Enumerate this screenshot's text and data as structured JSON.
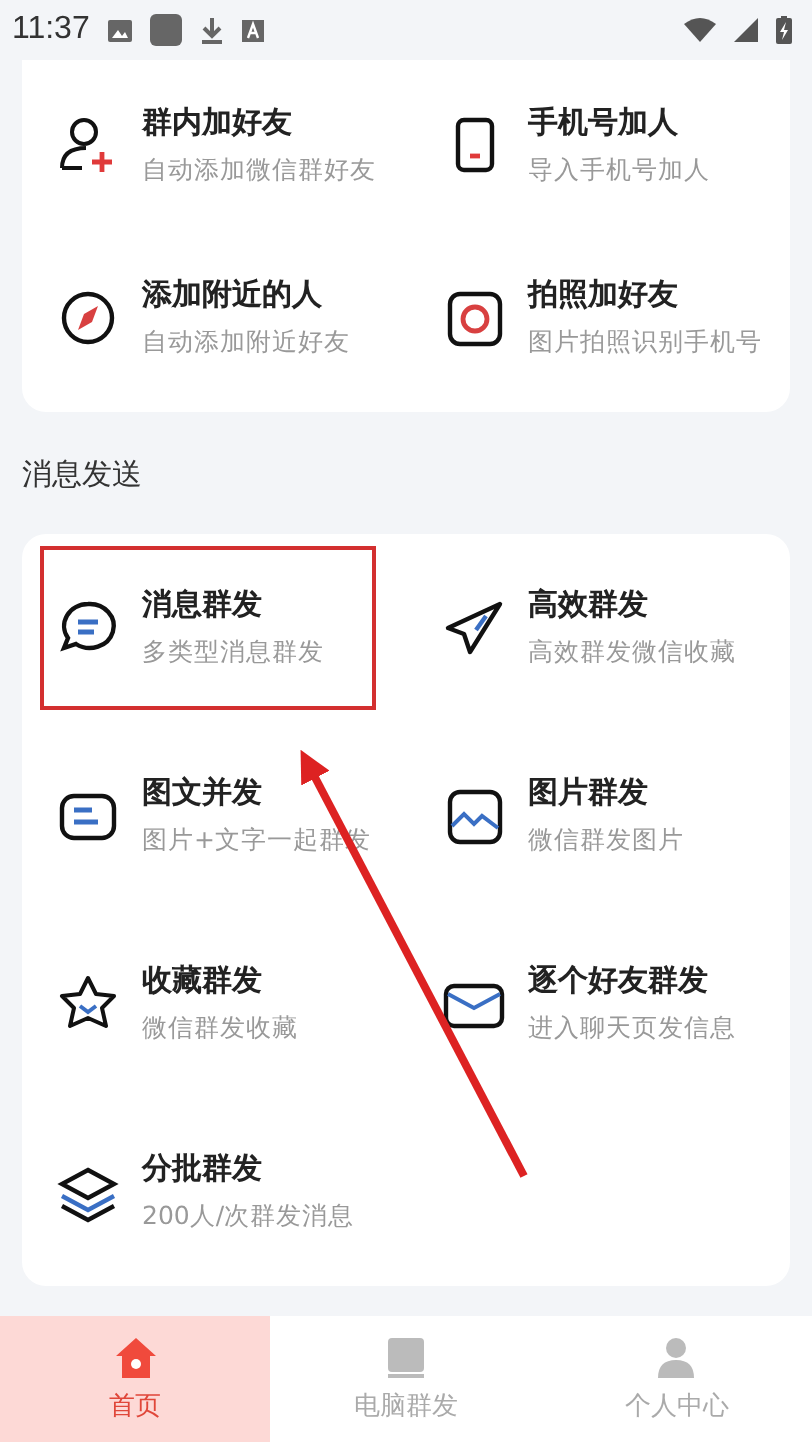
{
  "status_bar": {
    "time": "11:37"
  },
  "add_friends": {
    "items": [
      {
        "title": "群内加好友",
        "subtitle": "自动添加微信群好友"
      },
      {
        "title": "手机号加人",
        "subtitle": "导入手机号加人"
      },
      {
        "title": "添加附近的人",
        "subtitle": "自动添加附近好友"
      },
      {
        "title": "拍照加好友",
        "subtitle": "图片拍照识别手机号"
      }
    ]
  },
  "message_send": {
    "title": "消息发送",
    "items": [
      {
        "title": "消息群发",
        "subtitle": "多类型消息群发",
        "highlighted": true
      },
      {
        "title": "高效群发",
        "subtitle": "高效群发微信收藏",
        "highlighted": false
      },
      {
        "title": "图文并发",
        "subtitle": "图片+文字一起群发",
        "highlighted": false
      },
      {
        "title": "图片群发",
        "subtitle": "微信群发图片",
        "highlighted": false
      },
      {
        "title": "收藏群发",
        "subtitle": "微信群发收藏",
        "highlighted": false
      },
      {
        "title": "逐个好友群发",
        "subtitle": "进入聊天页发信息",
        "highlighted": false
      },
      {
        "title": "分批群发",
        "subtitle": "200人/次群发消息",
        "highlighted": false
      }
    ]
  },
  "tabs": [
    {
      "label": "首页",
      "selected": true
    },
    {
      "label": "电脑群发",
      "selected": false
    },
    {
      "label": "个人中心",
      "selected": false
    }
  ]
}
